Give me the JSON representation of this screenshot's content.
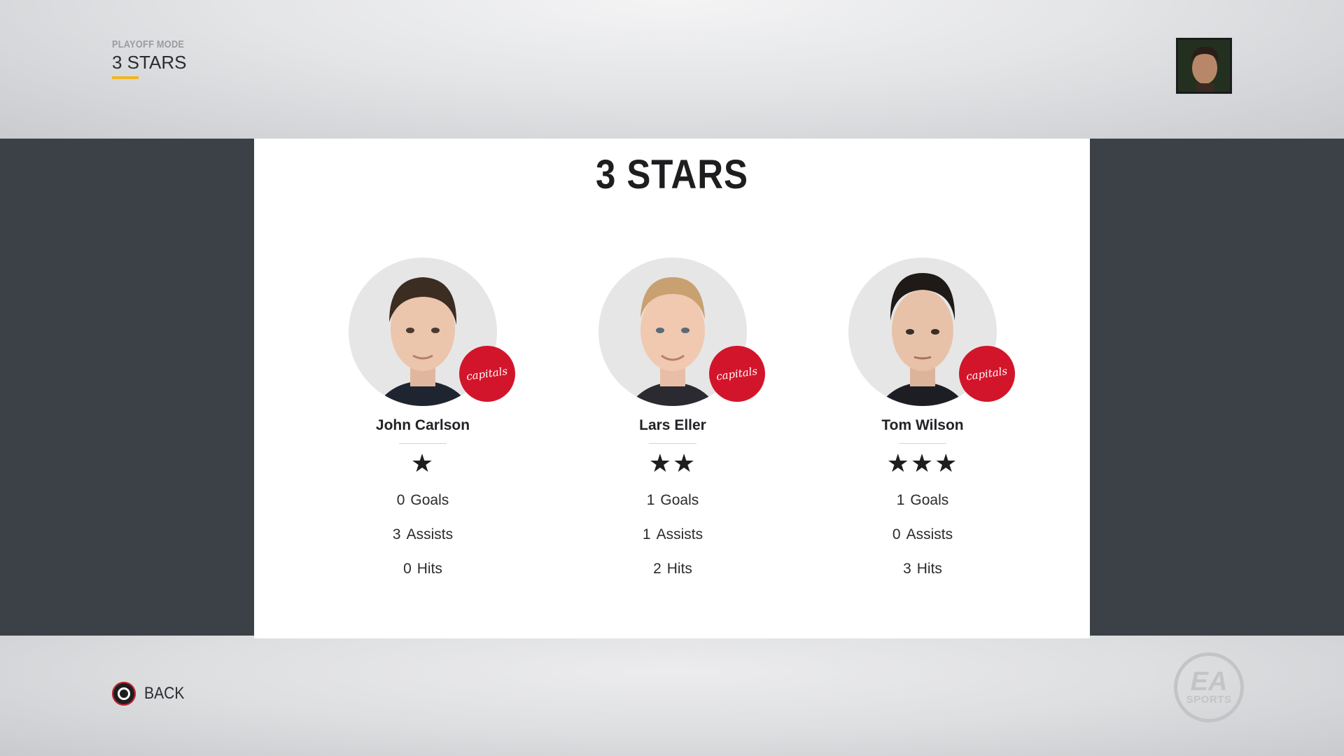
{
  "header": {
    "subtitle": "PLAYOFF MODE",
    "title": "3 STARS"
  },
  "panel": {
    "title": "3 STARS"
  },
  "players": [
    {
      "name": "John Carlson",
      "team_badge": "capitals",
      "stars": "★",
      "star_count": 1,
      "goals": "0",
      "goals_label": "Goals",
      "assists": "3",
      "assists_label": "Assists",
      "hits": "0",
      "hits_label": "Hits"
    },
    {
      "name": "Lars Eller",
      "team_badge": "capitals",
      "stars": "★★",
      "star_count": 2,
      "goals": "1",
      "goals_label": "Goals",
      "assists": "1",
      "assists_label": "Assists",
      "hits": "2",
      "hits_label": "Hits"
    },
    {
      "name": "Tom Wilson",
      "team_badge": "capitals",
      "stars": "★★★",
      "star_count": 3,
      "goals": "1",
      "goals_label": "Goals",
      "assists": "0",
      "assists_label": "Assists",
      "hits": "3",
      "hits_label": "Hits"
    }
  ],
  "footer": {
    "back_label": "BACK",
    "logo_top": "EA",
    "logo_bottom": "SPORTS"
  },
  "colors": {
    "accent": "#f2b51c",
    "team_red": "#d2152a",
    "panel_bg": "#ffffff",
    "side_bg": "#3c4148"
  }
}
